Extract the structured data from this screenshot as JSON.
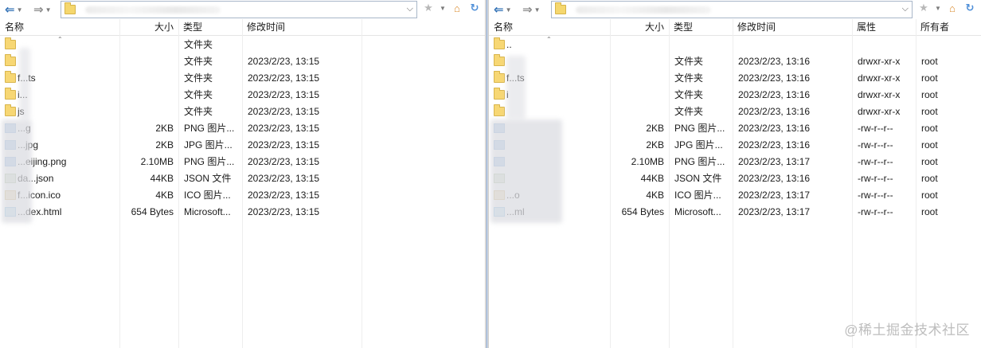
{
  "columns": {
    "name": "名称",
    "size": "大小",
    "type": "类型",
    "modified": "修改时间",
    "perms": "属性",
    "owner": "所有者"
  },
  "left": {
    "rows": [
      {
        "name": "",
        "size": "",
        "type": "文件夹",
        "modified": "",
        "icon": "folder-icon"
      },
      {
        "name": "",
        "size": "",
        "type": "文件夹",
        "modified": "2023/2/23, 13:15",
        "icon": "folder-icon"
      },
      {
        "name": "f...ts",
        "size": "",
        "type": "文件夹",
        "modified": "2023/2/23, 13:15",
        "icon": "folder-icon"
      },
      {
        "name": "i...",
        "size": "",
        "type": "文件夹",
        "modified": "2023/2/23, 13:15",
        "icon": "folder-icon"
      },
      {
        "name": "js",
        "size": "",
        "type": "文件夹",
        "modified": "2023/2/23, 13:15",
        "icon": "folder-icon"
      },
      {
        "name": "...g",
        "size": "2KB",
        "type": "PNG 图片...",
        "modified": "2023/2/23, 13:15",
        "icon": "png-file-icon"
      },
      {
        "name": "...jpg",
        "size": "2KB",
        "type": "JPG 图片...",
        "modified": "2023/2/23, 13:15",
        "icon": "jpg-file-icon"
      },
      {
        "name": "...eijing.png",
        "size": "2.10MB",
        "type": "PNG 图片...",
        "modified": "2023/2/23, 13:15",
        "icon": "png-file-icon"
      },
      {
        "name": "da...json",
        "size": "44KB",
        "type": "JSON 文件",
        "modified": "2023/2/23, 13:15",
        "icon": "json-file-icon"
      },
      {
        "name": "f...icon.ico",
        "size": "4KB",
        "type": "ICO 图片...",
        "modified": "2023/2/23, 13:15",
        "icon": "ico-file-icon"
      },
      {
        "name": "...dex.html",
        "size": "654 Bytes",
        "type": "Microsoft...",
        "modified": "2023/2/23, 13:15",
        "icon": "html-file-icon"
      }
    ]
  },
  "right": {
    "rows": [
      {
        "name": "..",
        "size": "",
        "type": "",
        "modified": "",
        "perms": "",
        "owner": "",
        "icon": "folder-up-icon"
      },
      {
        "name": "",
        "size": "",
        "type": "文件夹",
        "modified": "2023/2/23, 13:16",
        "perms": "drwxr-xr-x",
        "owner": "root",
        "icon": "folder-icon"
      },
      {
        "name": "f...ts",
        "size": "",
        "type": "文件夹",
        "modified": "2023/2/23, 13:16",
        "perms": "drwxr-xr-x",
        "owner": "root",
        "icon": "folder-icon"
      },
      {
        "name": "i",
        "size": "",
        "type": "文件夹",
        "modified": "2023/2/23, 13:16",
        "perms": "drwxr-xr-x",
        "owner": "root",
        "icon": "folder-icon"
      },
      {
        "name": "",
        "size": "",
        "type": "文件夹",
        "modified": "2023/2/23, 13:16",
        "perms": "drwxr-xr-x",
        "owner": "root",
        "icon": "folder-icon"
      },
      {
        "name": "",
        "size": "2KB",
        "type": "PNG 图片...",
        "modified": "2023/2/23, 13:16",
        "perms": "-rw-r--r--",
        "owner": "root",
        "icon": "png-file-icon"
      },
      {
        "name": "",
        "size": "2KB",
        "type": "JPG 图片...",
        "modified": "2023/2/23, 13:16",
        "perms": "-rw-r--r--",
        "owner": "root",
        "icon": "jpg-file-icon"
      },
      {
        "name": "",
        "size": "2.10MB",
        "type": "PNG 图片...",
        "modified": "2023/2/23, 13:17",
        "perms": "-rw-r--r--",
        "owner": "root",
        "icon": "png-file-icon"
      },
      {
        "name": "",
        "size": "44KB",
        "type": "JSON 文件",
        "modified": "2023/2/23, 13:16",
        "perms": "-rw-r--r--",
        "owner": "root",
        "icon": "json-file-icon"
      },
      {
        "name": "...o",
        "size": "4KB",
        "type": "ICO 图片...",
        "modified": "2023/2/23, 13:17",
        "perms": "-rw-r--r--",
        "owner": "root",
        "icon": "ico-file-icon"
      },
      {
        "name": "...ml",
        "size": "654 Bytes",
        "type": "Microsoft...",
        "modified": "2023/2/23, 13:17",
        "perms": "-rw-r--r--",
        "owner": "root",
        "icon": "html-file-icon"
      }
    ]
  },
  "watermark": "@稀土掘金技术社区"
}
